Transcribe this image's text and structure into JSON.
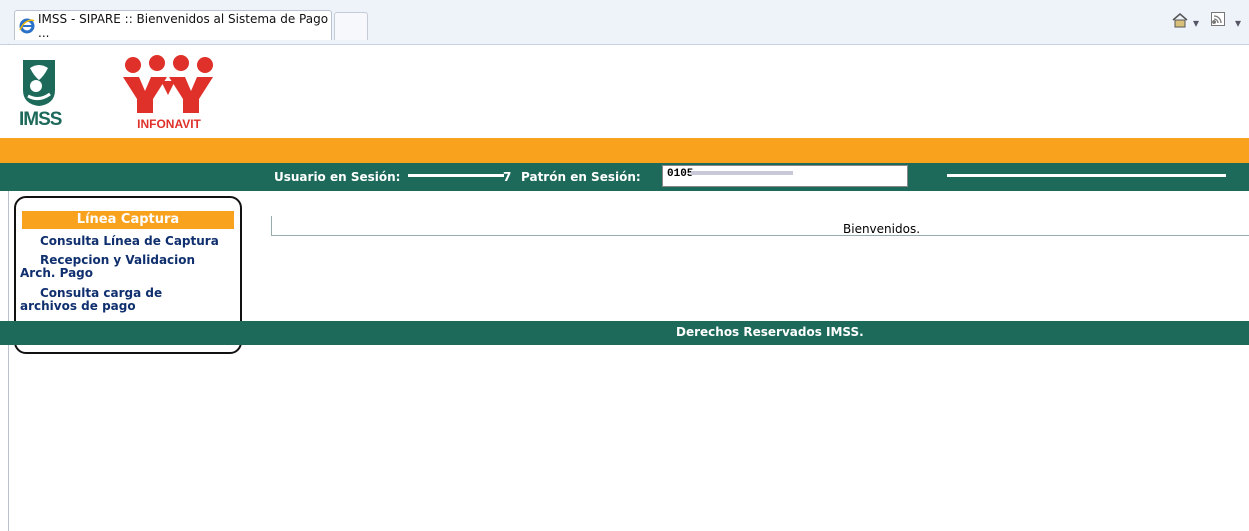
{
  "browser": {
    "tab_title": "IMSS - SIPARE :: Bienvenidos al Sistema de Pago ...",
    "icons": [
      "ie-icon",
      "home-icon",
      "dropdown-icon",
      "rss-icon",
      "dropdown-icon"
    ]
  },
  "header": {
    "imss_logo_text": "IMSS",
    "infonavit_logo_text": "INFONAVIT",
    "colors": {
      "orange": "#f9a21e",
      "green": "#1d6a5b",
      "infonavit_red": "#e0302a"
    }
  },
  "session": {
    "usuario_label": "Usuario en Sesión:",
    "usuario_suffix": "7",
    "patron_label": "Patrón en Sesión:",
    "patron_value": "0105"
  },
  "sidebar": {
    "title": "Línea Captura",
    "items": [
      {
        "label_line1": "Consulta Línea de Captura",
        "label_line2": ""
      },
      {
        "label_line1": "Recepcion y Validacion",
        "label_line2": "Arch. Pago"
      },
      {
        "label_line1": "Consulta carga de",
        "label_line2": "archivos de pago"
      }
    ]
  },
  "main": {
    "welcome": "Bienvenidos."
  },
  "footer": {
    "text": "Derechos Reservados IMSS."
  }
}
